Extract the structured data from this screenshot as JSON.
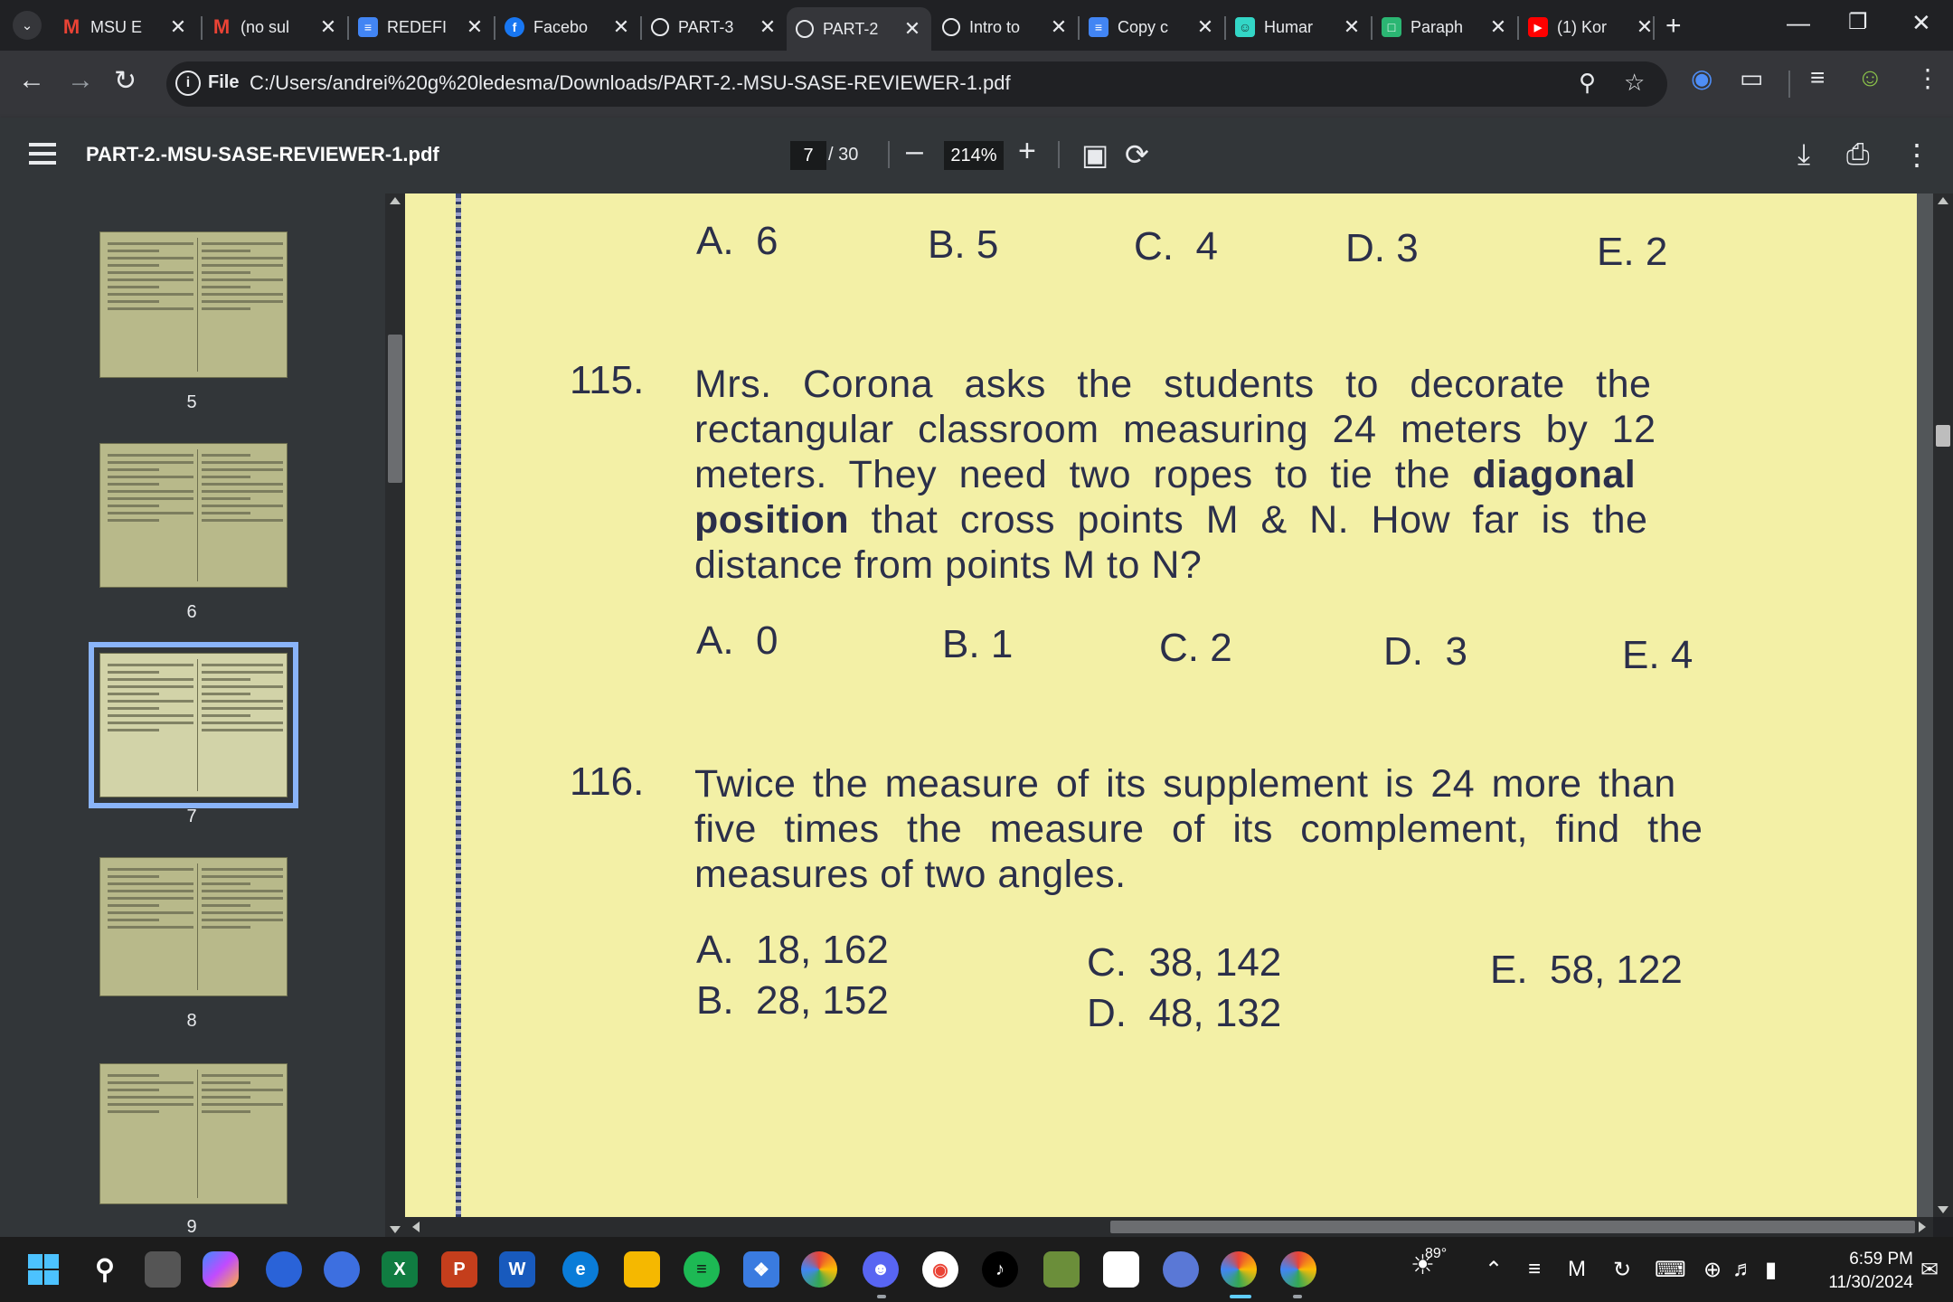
{
  "tabs": [
    {
      "title": "MSU E",
      "favicon": "gmail-icon"
    },
    {
      "title": "(no sul",
      "favicon": "gmail-icon"
    },
    {
      "title": "REDEFI",
      "favicon": "docs-icon"
    },
    {
      "title": "Facebo",
      "favicon": "facebook-icon"
    },
    {
      "title": "PART-3",
      "favicon": "globe-icon"
    },
    {
      "title": "PART-2",
      "favicon": "globe-icon",
      "active": true
    },
    {
      "title": "Intro to",
      "favicon": "globe-icon"
    },
    {
      "title": "Copy c",
      "favicon": "docs-icon"
    },
    {
      "title": "Humar",
      "favicon": "humanizer-icon"
    },
    {
      "title": "Paraph",
      "favicon": "paraphrase-icon"
    },
    {
      "title": "(1) Kor",
      "favicon": "youtube-icon"
    }
  ],
  "address_bar": {
    "scheme_label": "File",
    "url": "C:/Users/andrei%20g%20ledesma/Downloads/PART-2.-MSU-SASE-REVIEWER-1.pdf"
  },
  "pdf_toolbar": {
    "file_name": "PART-2.-MSU-SASE-REVIEWER-1.pdf",
    "current_page": "7",
    "total_pages": "/ 30",
    "zoom": "214%"
  },
  "sidebar": {
    "thumbnails": [
      {
        "page": "5"
      },
      {
        "page": "6"
      },
      {
        "page": "7",
        "selected": true
      },
      {
        "page": "8"
      },
      {
        "page": "9"
      }
    ]
  },
  "document": {
    "prev_options": [
      {
        "letter": "A.",
        "value": "6"
      },
      {
        "letter": "B.",
        "value": "5"
      },
      {
        "letter": "C.",
        "value": "4"
      },
      {
        "letter": "D.",
        "value": "3"
      },
      {
        "letter": "E.",
        "value": "2"
      }
    ],
    "q115": {
      "number": "115.",
      "line1": "Mrs. Corona asks the students to decorate the",
      "line2": "rectangular classroom measuring 24 meters by 12",
      "line3a": "meters. They need two ropes to tie the ",
      "line3b": "diagonal",
      "line4a": "position",
      "line4b": " that cross points M & N. How far is the",
      "line5": "distance from points M to N?",
      "options": [
        {
          "letter": "A.",
          "value": "0"
        },
        {
          "letter": "B.",
          "value": "1"
        },
        {
          "letter": "C.",
          "value": "2"
        },
        {
          "letter": "D.",
          "value": "3"
        },
        {
          "letter": "E.",
          "value": "4"
        }
      ]
    },
    "q116": {
      "number": "116.",
      "line1": "Twice the measure of its supplement is 24 more than",
      "line2": "five times the measure of its complement, find the",
      "line3": "measures of two angles.",
      "options": [
        {
          "letter": "A.",
          "value": "18, 162"
        },
        {
          "letter": "B.",
          "value": "28, 152"
        },
        {
          "letter": "C.",
          "value": "38, 142"
        },
        {
          "letter": "D.",
          "value": "48, 132"
        },
        {
          "letter": "E.",
          "value": "58, 122"
        }
      ]
    }
  },
  "taskbar": {
    "weather_temp": "89°",
    "time": "6:59 PM",
    "date": "11/30/2024"
  },
  "colors": {
    "page_bg": "#f3f0a6",
    "ink": "#2b2f4a",
    "accent": "#8ab4f8"
  }
}
